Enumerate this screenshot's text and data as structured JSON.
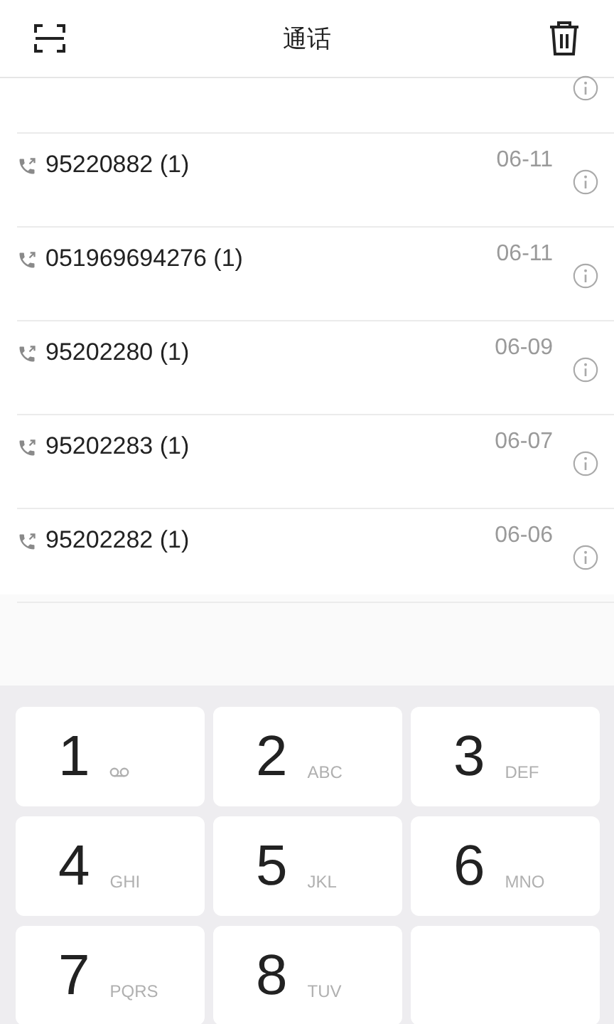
{
  "header": {
    "title": "通话"
  },
  "calls": [
    {
      "kind": "partial"
    },
    {
      "kind": "full",
      "number": "95220882 (1)",
      "date": "06-11"
    },
    {
      "kind": "full",
      "number": "051969694276 (1)",
      "date": "06-11"
    },
    {
      "kind": "full",
      "number": "95202280 (1)",
      "date": "06-09"
    },
    {
      "kind": "full",
      "number": "95202283 (1)",
      "date": "06-07"
    },
    {
      "kind": "full",
      "number": "95202282 (1)",
      "date": "06-06"
    }
  ],
  "keypad": [
    {
      "kind": "voicemail",
      "digit": "1"
    },
    {
      "kind": "letters",
      "digit": "2",
      "letters": "ABC"
    },
    {
      "kind": "letters",
      "digit": "3",
      "letters": "DEF"
    },
    {
      "kind": "letters",
      "digit": "4",
      "letters": "GHI"
    },
    {
      "kind": "letters",
      "digit": "5",
      "letters": "JKL"
    },
    {
      "kind": "letters",
      "digit": "6",
      "letters": "MNO"
    },
    {
      "kind": "letters",
      "digit": "7",
      "letters": "PQRS"
    },
    {
      "kind": "letters",
      "digit": "8",
      "letters": "TUV"
    },
    {
      "kind": "covered"
    }
  ]
}
